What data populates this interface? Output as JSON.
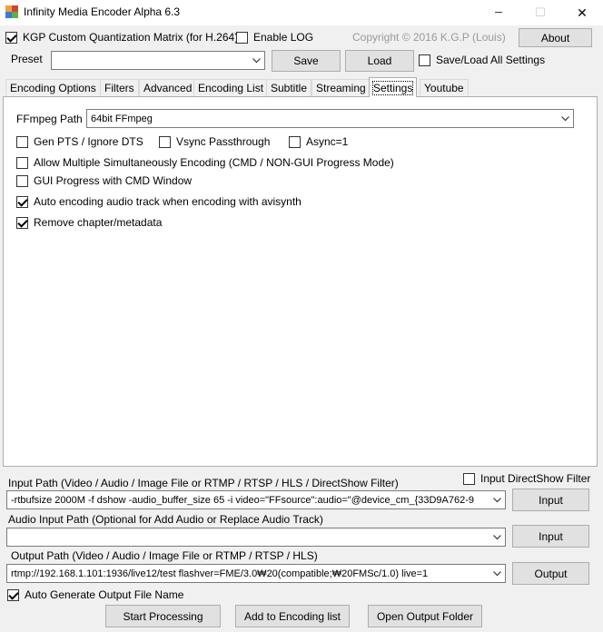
{
  "window": {
    "title": "Infinity Media Encoder Alpha 6.3",
    "minimize_glyph": "─",
    "maximize_glyph": "☐",
    "close_glyph": "✕"
  },
  "top": {
    "kgp_label": "KGP Custom Quantization Matrix (for H.264)",
    "kgp_checked": true,
    "enable_log_label": "Enable LOG",
    "enable_log_checked": false,
    "copyright": "Copyright © 2016 K.G.P (Louis)",
    "about_label": "About"
  },
  "preset": {
    "label": "Preset",
    "value": "",
    "save_label": "Save",
    "load_label": "Load",
    "save_load_all_label": "Save/Load All Settings",
    "save_load_all_checked": false
  },
  "tabs": [
    {
      "label": "Encoding Options"
    },
    {
      "label": "Filters"
    },
    {
      "label": "Advanced"
    },
    {
      "label": "Encoding List"
    },
    {
      "label": "Subtitle"
    },
    {
      "label": "Streaming"
    },
    {
      "label": "Settings"
    },
    {
      "label": "Youtube"
    }
  ],
  "settings": {
    "ffmpeg_path_label": "FFmpeg Path",
    "ffmpeg_path_value": "64bit FFmpeg",
    "gen_pts_label": "Gen PTS / Ignore DTS",
    "vsync_label": "Vsync Passthrough",
    "async_label": "Async=1",
    "allow_multi_label": "Allow Multiple Simultaneously Encoding (CMD / NON-GUI Progress Mode)",
    "gui_progress_label": "GUI Progress with CMD Window",
    "auto_audio_label": "Auto encoding audio track when encoding with avisynth",
    "remove_chapter_label": "Remove chapter/metadata"
  },
  "io": {
    "input_path_label": "Input Path (Video / Audio / Image File or RTMP / RTSP / HLS / DirectShow Filter)",
    "input_directshow_label": "Input DirectShow Filter",
    "input_value": "-rtbufsize 2000M -f dshow -audio_buffer_size 65 -i video=\"FFsource\":audio=\"@device_cm_{33D9A762-9",
    "input_button": "Input",
    "audio_input_label": "Audio Input Path (Optional for Add Audio or Replace Audio Track)",
    "audio_input_value": "",
    "audio_input_button": "Input",
    "output_path_label": "Output Path (Video / Audio / Image File or RTMP / RTSP / HLS)",
    "output_value": "rtmp://192.168.1.101:1936/live12/test flashver=FME/3.0₩20(compatible;₩20FMSc/1.0) live=1",
    "output_button": "Output",
    "auto_generate_label": "Auto Generate Output File Name"
  },
  "bottom": {
    "start_label": "Start Processing",
    "add_list_label": "Add to Encoding list",
    "open_folder_label": "Open Output Folder"
  }
}
